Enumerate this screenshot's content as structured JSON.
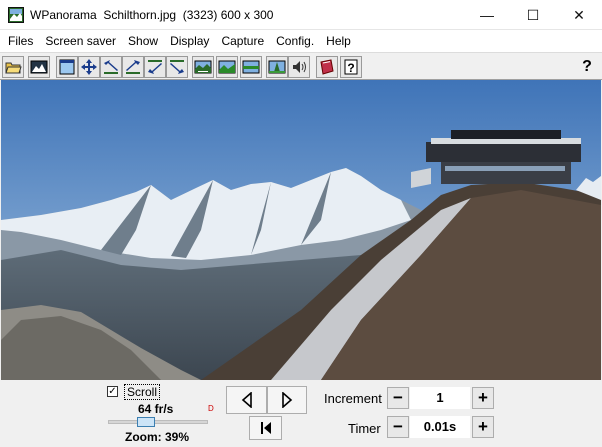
{
  "window": {
    "title": "WPanorama  Schilthorn.jpg  (3323) 600 x 300",
    "minimize_glyph": "—",
    "maximize_glyph": "☐",
    "close_glyph": "✕"
  },
  "menu": [
    "Files",
    "Screen saver",
    "Show",
    "Display",
    "Capture",
    "Config.",
    "Help"
  ],
  "toolbar": {
    "buttons": [
      "open-file-icon",
      "image-icon",
      "fit-window-icon",
      "move-icon",
      "arrow-left-up-icon",
      "arrow-right-up-icon",
      "arrow-left-down-icon",
      "arrow-right-down-icon",
      "panorama-icon",
      "landscape-icon",
      "horizon-icon",
      "ground-icon",
      "sound-icon",
      "book-icon",
      "help-file-icon"
    ],
    "help_label": "?"
  },
  "image": {
    "description_icon": "mountain-panorama-image"
  },
  "controls": {
    "scroll_label": "Scroll",
    "scroll_checked": true,
    "scroll_check_glyph": "✓",
    "fps_text": "64 fr/s",
    "zoom_text": "Zoom: 39%",
    "zoom_slider_fraction": 0.39,
    "small_mark": "D",
    "increment_label": "Increment",
    "increment_value": "1",
    "timer_label": "Timer",
    "timer_value": "0.01s",
    "minus_label": "−",
    "plus_label": "+"
  }
}
